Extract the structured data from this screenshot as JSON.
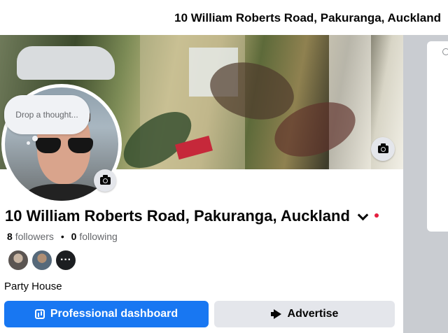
{
  "header": {
    "title": "10 William Roberts Road, Pakuranga, Auckland"
  },
  "thought_bubble": {
    "placeholder": "Drop a thought..."
  },
  "profile": {
    "name": "10 William Roberts Road, Pakuranga, Auckland",
    "followers_count": "8",
    "followers_label": "followers",
    "separator": "•",
    "following_count": "0",
    "following_label": "following",
    "more_friends": "···",
    "category": "Party House"
  },
  "actions": {
    "primary_label": "Professional dashboard",
    "secondary_label": "Advertise"
  },
  "icons": {
    "cover_camera": "camera-icon",
    "avatar_camera": "camera-icon",
    "name_dropdown": "chevron-down-icon",
    "dashboard": "dashboard-icon",
    "advertise": "megaphone-icon"
  },
  "colors": {
    "primary_button": "#1877f2",
    "secondary_button": "#e4e6eb",
    "notification_dot": "#e41e3f",
    "rail_background": "#c9ccd1"
  }
}
